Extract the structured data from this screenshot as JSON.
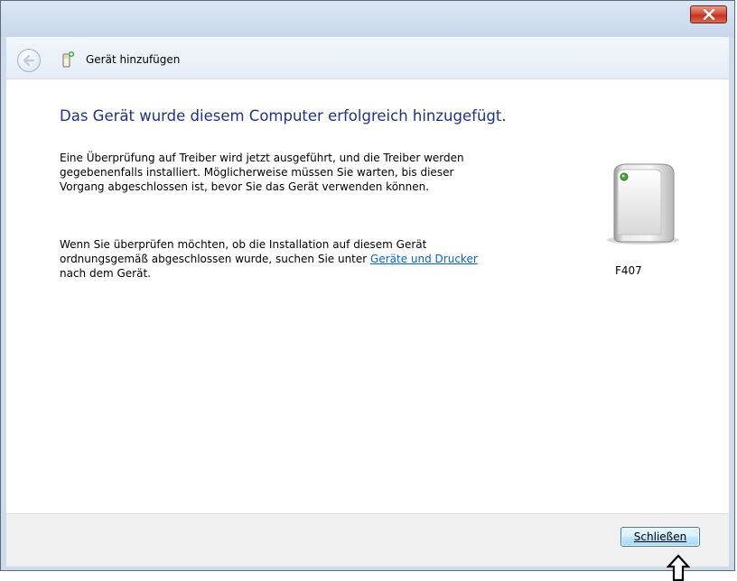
{
  "window": {
    "nav_title": "Gerät hinzufügen",
    "accent": "#1e3287",
    "link_color": "#0066cc"
  },
  "content": {
    "heading": "Das Gerät wurde diesem Computer erfolgreich hinzugefügt.",
    "paragraph1": "Eine Überprüfung auf Treiber wird jetzt ausgeführt, und die Treiber werden gegebenenfalls installiert. Möglicherweise müssen Sie warten, bis dieser Vorgang abgeschlossen ist, bevor Sie das Gerät verwenden können.",
    "paragraph2_before": "Wenn Sie überprüfen möchten, ob die Installation auf diesem Gerät ordnungsgemäß abgeschlossen wurde, suchen Sie unter ",
    "paragraph2_link": "Geräte und Drucker",
    "paragraph2_after": " nach dem Gerät.",
    "device_label": "F407"
  },
  "footer": {
    "close_button_prefix": "S",
    "close_button_access_key": "c",
    "close_button_suffix": "hließen"
  },
  "icons": {
    "window_close": "close-x-icon",
    "back": "back-arrow-icon",
    "nav": "device-add-icon",
    "device": "device-tower-icon",
    "annotation": "up-arrow-icon"
  }
}
